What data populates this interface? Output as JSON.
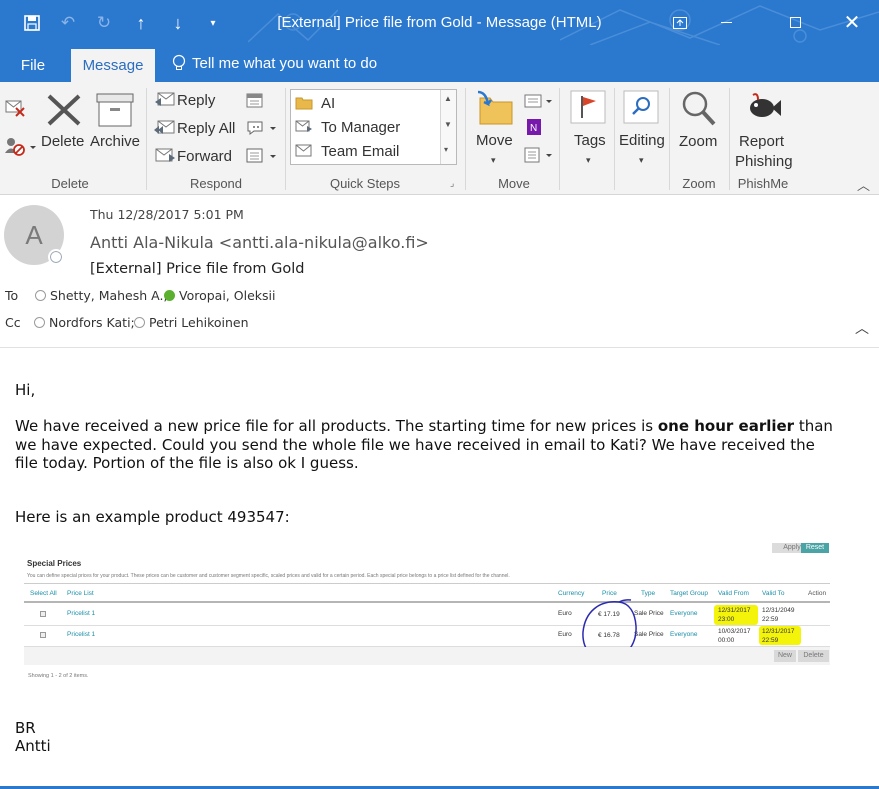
{
  "window": {
    "title": "[External] Price file from Gold  -  Message (HTML)"
  },
  "tabs": [
    {
      "label": "File"
    },
    {
      "label": "Message"
    }
  ],
  "tell_me": "Tell me what you want to do",
  "ribbon": {
    "delete_group": {
      "delete": "Delete",
      "archive": "Archive",
      "label": "Delete"
    },
    "respond_group": {
      "reply": "Reply",
      "reply_all": "Reply All",
      "forward": "Forward",
      "label": "Respond"
    },
    "quick_steps": {
      "items": [
        "AI",
        "To Manager",
        "Team Email"
      ],
      "label": "Quick Steps"
    },
    "move_group": {
      "move": "Move",
      "label": "Move"
    },
    "tags": "Tags",
    "editing": "Editing",
    "zoom_group": {
      "zoom": "Zoom",
      "label": "Zoom"
    },
    "phishme_group": {
      "line1": "Report",
      "line2": "Phishing",
      "label": "PhishMe"
    }
  },
  "message": {
    "avatar_letter": "A",
    "date": "Thu 12/28/2017 5:01 PM",
    "from": "Antti Ala-Nikula <antti.ala-nikula@alko.fi>",
    "subject": "[External] Price file from Gold",
    "to_label": "To",
    "to": [
      "Shetty, Mahesh A.;",
      "Voropai, Oleksii"
    ],
    "cc_label": "Cc",
    "cc": [
      "Nordfors Kati;",
      "Petri Lehikoinen"
    ]
  },
  "body": {
    "greeting": "Hi,",
    "p1_a": "We have received a new price file for all products. The starting time for new prices is ",
    "p1_bold": "one hour earlier",
    "p1_b": " than",
    "p1_line2": "we have expected. Could you send the whole file we have received in email to Kati? We have received the",
    "p1_line3": "file today. Portion of the file is also ok I guess.",
    "p2": "Here is an example product 493547:",
    "sign1": "BR",
    "sign2": "Antti"
  },
  "embedded": {
    "apply": "Apply",
    "reset": "Reset",
    "heading": "Special Prices",
    "description": "You can define special prices for your product. These prices can be customer and customer segment specific, scaled prices and valid for a certain period. Each special price belongs to a price list defined for the channel.",
    "columns": [
      "Select All",
      "Price List",
      "Currency",
      "Price",
      "Type",
      "Target Group",
      "Valid From",
      "Valid To",
      "Action"
    ],
    "rows": [
      {
        "price_list": "Pricelist 1",
        "currency": "Euro",
        "price": "€ 17.19",
        "type": "Sale Price",
        "target": "Everyone",
        "from_date": "12/31/2017",
        "from_time": "23:00",
        "to_date": "12/31/2049",
        "to_time": "22:59"
      },
      {
        "price_list": "Pricelist 1",
        "currency": "Euro",
        "price": "€ 16.78",
        "type": "Sale Price",
        "target": "Everyone",
        "from_date": "10/03/2017",
        "from_time": "00:00",
        "to_date": "12/31/2017",
        "to_time": "22:59"
      }
    ],
    "new": "New",
    "delete": "Delete",
    "showing": "Showing  1  -  2  of  2  items."
  },
  "colors": {
    "accent": "#2b78cf",
    "highlight": "#f4f40b",
    "link": "#1a8ea8"
  }
}
